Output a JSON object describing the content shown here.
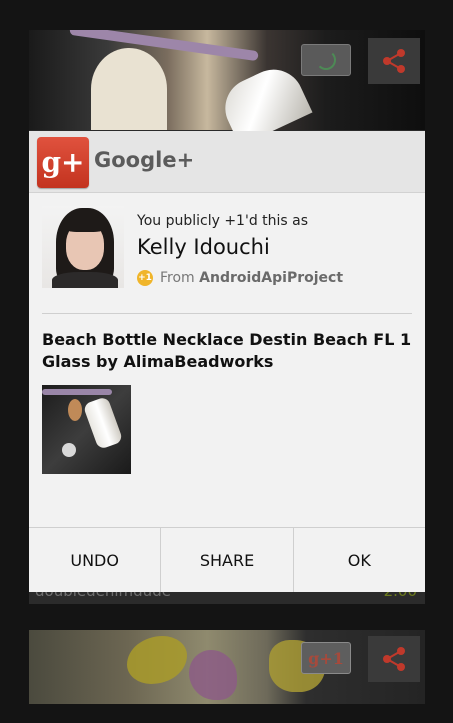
{
  "background": {
    "card_top": {
      "username": "doubledenimdude",
      "price": "2.00"
    },
    "card_bottom": {
      "plus_one_label": "g+1"
    }
  },
  "dialog": {
    "app_name": "Google+",
    "logo_text": "g+",
    "activity_text": "You publicly +1'd this as",
    "user_name": "Kelly Idouchi",
    "from_prefix": "From",
    "from_app": "AndroidApiProject",
    "post_title": "Beach Bottle Necklace Destin Beach FL 1 Glass by AlimaBeadworks",
    "buttons": {
      "undo": "UNDO",
      "share": "SHARE",
      "ok": "OK"
    }
  },
  "colors": {
    "gplus_red": "#d1432f",
    "share_red": "#c0392b",
    "price_green": "#6b7a1c",
    "page_bg": "#141414"
  },
  "icons": {
    "share": "share-icon",
    "loading": "loading-spinner-icon",
    "google_plus_logo": "google-plus-logo",
    "from_app": "google-plus-one-badge-icon"
  }
}
